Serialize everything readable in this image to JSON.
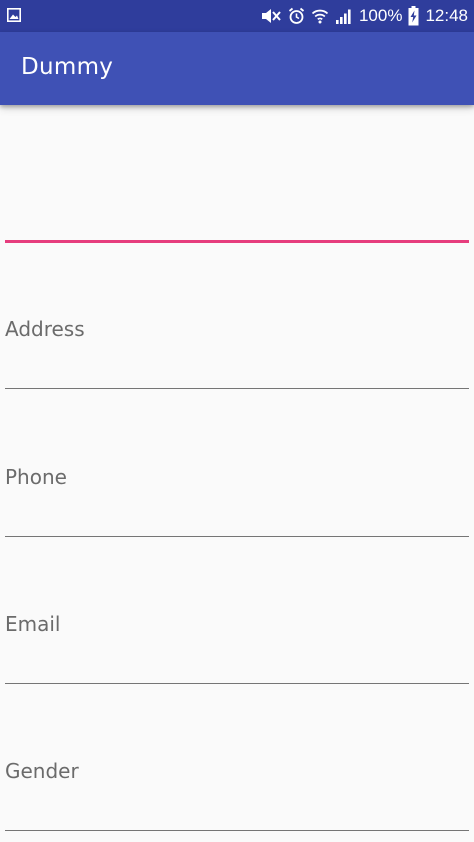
{
  "status_bar": {
    "battery": "100%",
    "time": "12:48",
    "icons": [
      "gallery-icon",
      "mute-icon",
      "alarm-icon",
      "wifi-icon",
      "signal-icon",
      "battery-charging-icon"
    ]
  },
  "app_bar": {
    "title": "Dummy"
  },
  "form": {
    "fields": [
      {
        "hint": "",
        "focused": true
      },
      {
        "hint": "Address"
      },
      {
        "hint": "Phone"
      },
      {
        "hint": "Email"
      },
      {
        "hint": "Gender"
      }
    ]
  },
  "colors": {
    "status_bar": "#2f3d9c",
    "app_bar": "#3f51b5",
    "accent": "#e63d7d",
    "underline": "#757575",
    "hint_text": "#6b6b6b",
    "background": "#fafafa"
  }
}
